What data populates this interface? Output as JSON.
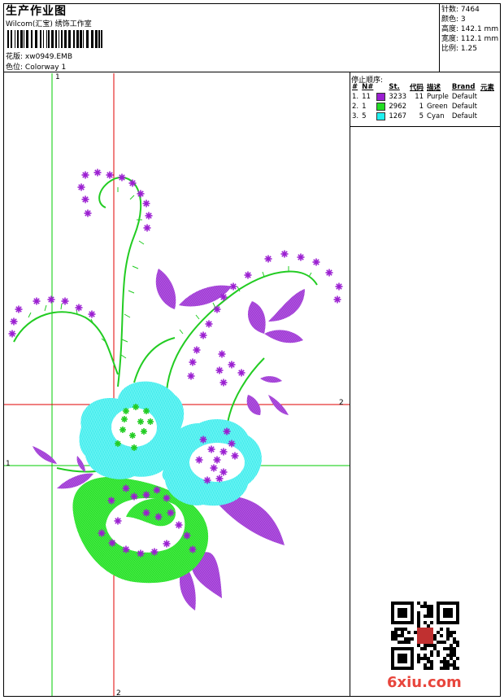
{
  "header": {
    "title": "生产作业图",
    "company": "Wilcom(汇宝) 绣饰工作室",
    "pattern_label": "花版:",
    "pattern_value": "xw0949.EMB",
    "colorway_label": "色位:",
    "colorway_value": "Colorway 1"
  },
  "stats": {
    "stitches_label": "针数:",
    "stitches_value": "7464",
    "colors_label": "颜色:",
    "colors_value": "3",
    "height_label": "高度:",
    "height_value": "142.1 mm",
    "width_label": "宽度:",
    "width_value": "112.1 mm",
    "scale_label": "比例:",
    "scale_value": "1.25"
  },
  "stop_sequence": {
    "title": "停止顺序:",
    "columns": [
      "#",
      "N#",
      "St.",
      "代码",
      "描述",
      "Brand",
      "元素"
    ],
    "rows": [
      {
        "num": "1.",
        "n": "11",
        "color": "#9b1fd1",
        "stitches": "3233",
        "code": "11",
        "desc": "Purple",
        "brand": "Default"
      },
      {
        "num": "2.",
        "n": "1",
        "color": "#22dd22",
        "stitches": "2962",
        "code": "1",
        "desc": "Green",
        "brand": "Default"
      },
      {
        "num": "3.",
        "n": "5",
        "color": "#1ff0f0",
        "stitches": "1267",
        "code": "5",
        "desc": "Cyan",
        "brand": "Default"
      }
    ]
  },
  "guides": {
    "green_v_label": "1",
    "green_h_label": "1",
    "red_h_label": "2",
    "red_v_label": "2"
  },
  "colors": {
    "purple": "#9b1fd1",
    "green": "#22dd22",
    "cyan": "#1ff0f0",
    "red_guide": "#e00000",
    "green_guide": "#00cc00"
  },
  "watermark": {
    "logo_text": "6xiu.com"
  }
}
